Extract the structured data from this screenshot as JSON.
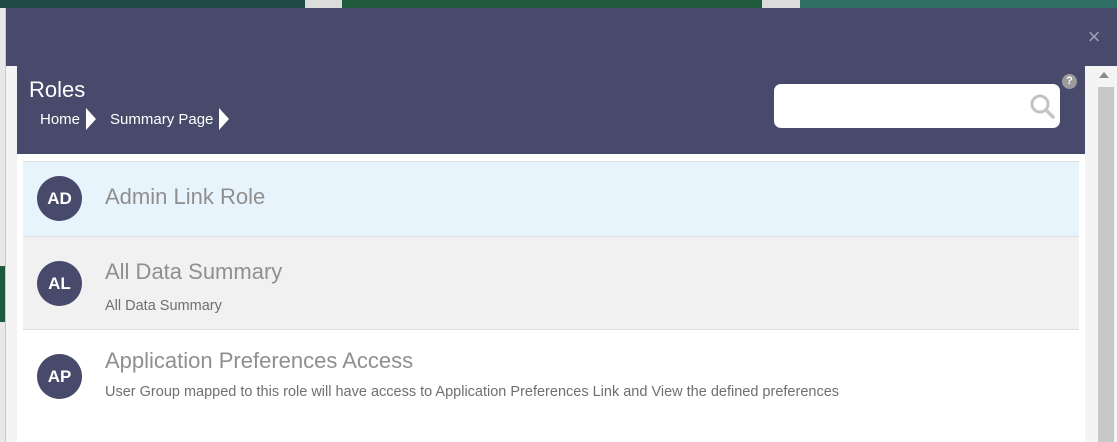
{
  "modal": {
    "close_label": "×"
  },
  "page": {
    "title": "Roles",
    "breadcrumb": [
      {
        "label": "Home"
      },
      {
        "label": "Summary Page"
      }
    ],
    "help_label": "?",
    "search": {
      "value": "",
      "placeholder": ""
    }
  },
  "roles": [
    {
      "initials": "AD",
      "name": "Admin Link Role",
      "description": ""
    },
    {
      "initials": "AL",
      "name": "All Data Summary",
      "description": "All Data Summary"
    },
    {
      "initials": "AP",
      "name": "Application Preferences Access",
      "description": "User Group mapped to this role will have access to Application Preferences Link and View the defined preferences"
    }
  ],
  "colors": {
    "header": "#474a6a",
    "selected_row": "#e8f4fb",
    "avatar": "#474a6a"
  },
  "icons": {
    "close": "close-icon",
    "help": "help-icon",
    "search": "search-icon",
    "breadcrumb_separator": "chevron-right-icon"
  }
}
